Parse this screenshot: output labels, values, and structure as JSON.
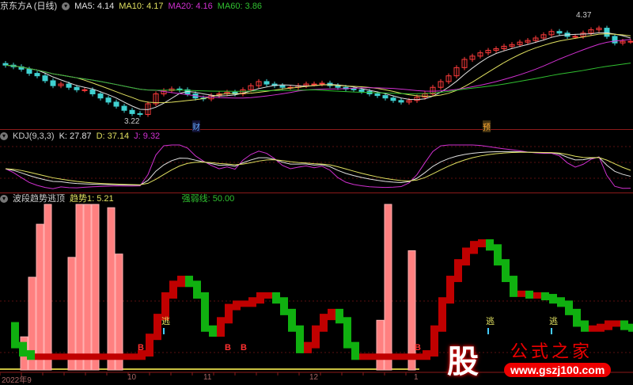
{
  "main": {
    "title": "京东方A (日线)",
    "ma5": "MA5: 4.14",
    "ma10": "MA10: 4.17",
    "ma20": "MA20: 4.16",
    "ma60": "MA60: 3.86",
    "high_label": "4.37",
    "low_label": "3.22",
    "marker_cai": "财",
    "marker_yu": "预"
  },
  "kdj": {
    "title": "KDJ(9,3,3)",
    "k": "K: 27.87",
    "d": "D: 37.14",
    "j": "J: 9.32"
  },
  "lower": {
    "title": "波段趋势逃顶",
    "trend": "趋势1: 5.21",
    "strength": "强弱线: 50.00",
    "escape_label": "逃",
    "buy_label": "B"
  },
  "axis": {
    "labels": [
      "2022年9",
      "10",
      "11",
      "12",
      "1"
    ]
  },
  "logo": {
    "char": "股",
    "name": "公式之家",
    "url": "www.gszj100.com"
  },
  "colors": {
    "up": "#ff3b3b",
    "down": "#3fd0d0",
    "ma5": "#e0e0e0",
    "ma10": "#e0e060",
    "ma20": "#d030d0",
    "ma60": "#30c030"
  },
  "chart_data": {
    "type": "candlestick",
    "closes": [
      3.85,
      3.83,
      3.8,
      3.75,
      3.72,
      3.66,
      3.6,
      3.62,
      3.58,
      3.55,
      3.55,
      3.5,
      3.45,
      3.4,
      3.35,
      3.3,
      3.26,
      3.25,
      3.38,
      3.5,
      3.54,
      3.56,
      3.55,
      3.5,
      3.45,
      3.44,
      3.48,
      3.5,
      3.52,
      3.5,
      3.55,
      3.6,
      3.65,
      3.62,
      3.6,
      3.58,
      3.58,
      3.6,
      3.62,
      3.62,
      3.63,
      3.6,
      3.58,
      3.56,
      3.55,
      3.53,
      3.5,
      3.48,
      3.45,
      3.42,
      3.4,
      3.42,
      3.46,
      3.5,
      3.58,
      3.65,
      3.72,
      3.82,
      3.92,
      3.96,
      4.0,
      4.03,
      4.05,
      4.08,
      4.1,
      4.13,
      4.15,
      4.18,
      4.22,
      4.26,
      4.24,
      4.2,
      4.2,
      4.24,
      4.28,
      4.3,
      4.2,
      4.12,
      4.14,
      4.14
    ],
    "price_range": [
      3.1,
      4.45
    ],
    "trend": [
      27,
      15,
      10,
      8,
      8,
      8,
      8,
      8,
      8,
      8,
      8,
      8,
      8,
      8,
      8,
      8,
      8,
      10,
      20,
      32,
      45,
      52,
      55,
      52,
      45,
      25,
      22,
      30,
      38,
      40,
      40,
      42,
      45,
      45,
      42,
      35,
      25,
      12,
      15,
      25,
      32,
      35,
      30,
      15,
      8,
      8,
      8,
      8,
      8,
      8,
      8,
      8,
      8,
      10,
      25,
      42,
      55,
      65,
      72,
      76,
      77,
      74,
      65,
      55,
      46,
      46,
      45,
      45,
      44,
      42,
      40,
      35,
      28,
      25,
      25,
      26,
      28,
      28,
      26,
      25
    ],
    "bars": [
      {
        "i": 2,
        "v": 20
      },
      {
        "i": 3,
        "v": 56
      },
      {
        "i": 4,
        "v": 88
      },
      {
        "i": 5,
        "v": 100
      },
      {
        "i": 8,
        "v": 68
      },
      {
        "i": 9,
        "v": 100
      },
      {
        "i": 10,
        "v": 100
      },
      {
        "i": 11,
        "v": 100
      },
      {
        "i": 13,
        "v": 98
      },
      {
        "i": 14,
        "v": 70
      },
      {
        "i": 47,
        "v": 30
      },
      {
        "i": 48,
        "v": 100
      },
      {
        "i": 51,
        "v": 72
      }
    ],
    "escape_idx": [
      20,
      61,
      69
    ],
    "buy_idx": [
      17,
      28,
      30,
      52
    ]
  }
}
